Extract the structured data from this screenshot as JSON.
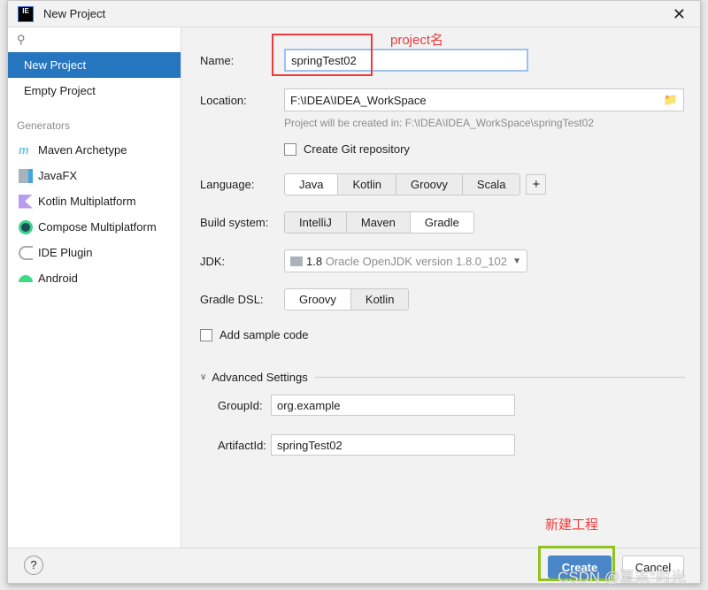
{
  "window": {
    "title": "New Project"
  },
  "sidebar": {
    "items": [
      {
        "label": "New Project",
        "selected": true
      },
      {
        "label": "Empty Project"
      }
    ],
    "generators_label": "Generators",
    "generators": [
      {
        "label": "Maven Archetype",
        "icon": "maven-icon"
      },
      {
        "label": "JavaFX",
        "icon": "javafx-icon"
      },
      {
        "label": "Kotlin Multiplatform",
        "icon": "kotlin-icon"
      },
      {
        "label": "Compose Multiplatform",
        "icon": "compose-icon"
      },
      {
        "label": "IDE Plugin",
        "icon": "plugin-icon"
      },
      {
        "label": "Android",
        "icon": "android-icon"
      }
    ]
  },
  "form": {
    "name_label": "Name:",
    "name_value": "springTest02",
    "location_label": "Location:",
    "location_value": "F:\\IDEA\\IDEA_WorkSpace",
    "location_hint": "Project will be created in: F:\\IDEA\\IDEA_WorkSpace\\springTest02",
    "git_label": "Create Git repository",
    "language_label": "Language:",
    "languages": [
      "Java",
      "Kotlin",
      "Groovy",
      "Scala"
    ],
    "language_selected": "Java",
    "build_label": "Build system:",
    "builds": [
      "IntelliJ",
      "Maven",
      "Gradle"
    ],
    "build_selected": "Gradle",
    "jdk_label": "JDK:",
    "jdk_version": "1.8",
    "jdk_desc": "Oracle OpenJDK version 1.8.0_102",
    "dsl_label": "Gradle DSL:",
    "dsls": [
      "Groovy",
      "Kotlin"
    ],
    "dsl_selected": "Groovy",
    "sample_label": "Add sample code",
    "advanced_label": "Advanced Settings",
    "groupid_label": "GroupId:",
    "groupid_value": "org.example",
    "artifactid_label": "ArtifactId:",
    "artifactid_value": "springTest02"
  },
  "footer": {
    "help": "?",
    "create": "Create",
    "cancel": "Cancel"
  },
  "annotations": {
    "name_note": "project名",
    "create_note": "新建工程",
    "watermark": "CSDN @夏末°时光"
  },
  "colors": {
    "accent": "#2675bf",
    "annotation_red": "#f03a3a",
    "annotation_green": "#8fc31f"
  }
}
